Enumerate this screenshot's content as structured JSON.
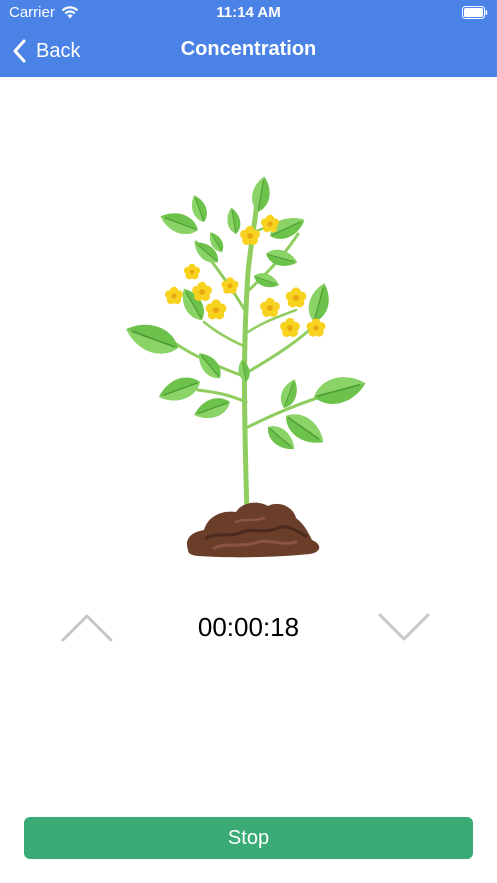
{
  "status_bar": {
    "carrier": "Carrier",
    "time": "11:14 AM",
    "wifi_icon": "wifi-icon",
    "battery_icon": "battery-icon"
  },
  "nav": {
    "back_label": "Back",
    "back_icon": "chevron-left-icon",
    "title": "Concentration"
  },
  "illustration": {
    "icon": "flowering-plant-illustration"
  },
  "timer": {
    "value": "00:00:18",
    "increase_icon": "chevron-up-icon",
    "decrease_icon": "chevron-down-icon"
  },
  "actions": {
    "stop_label": "Stop"
  },
  "colors": {
    "header": "#4a82e6",
    "stop_button": "#3aab74",
    "arrows": "#c7c7c7",
    "leaf": "#6cc24a",
    "soil": "#6b3e2a",
    "flower": "#f7d21e"
  }
}
